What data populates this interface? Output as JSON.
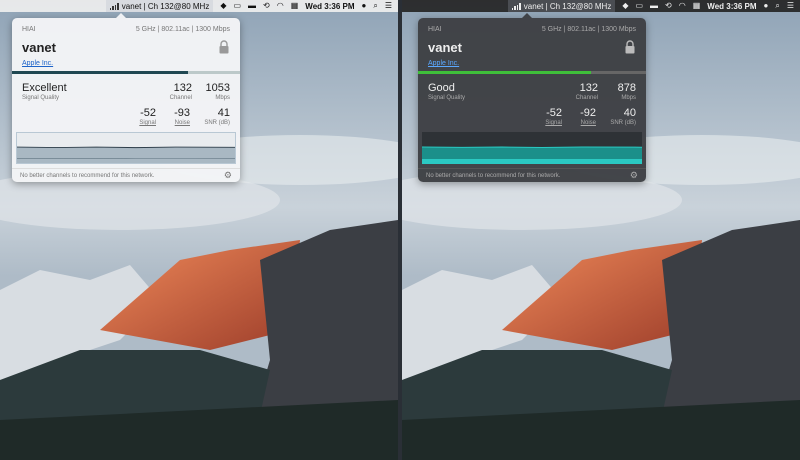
{
  "menubar": {
    "wifi_label": "vanet | Ch 132@80 MHz",
    "time": "Wed 3:36 PM"
  },
  "icons": {
    "dropbox": "◆",
    "airplay": "▭",
    "battery": "▬",
    "time_machine": "⟲",
    "wifi": "◠",
    "flag": "▦",
    "user": "●",
    "search": "⌕",
    "list": "☰",
    "gear": "⚙"
  },
  "colors": {
    "signal_bar_excellent": "#204852",
    "signal_bar_good": "#3fbf3a",
    "link": "#1d63c9"
  },
  "panels": [
    {
      "network_name": "HIAI",
      "band_info": "5 GHz | 802.11ac | 1300 Mbps",
      "ssid": "vanet",
      "vendor": "Apple Inc.",
      "signal_fraction": 0.77,
      "quality": "Excellent",
      "quality_label": "Signal Quality",
      "channel": "132",
      "channel_label": "Channel",
      "rate": "1053",
      "rate_label": "Mbps",
      "signal": "-52",
      "signal_label": "Signal",
      "noise": "-93",
      "noise_label": "Noise",
      "snr": "41",
      "snr_label": "SNR (dB)",
      "footer": "No better channels to recommend for this network."
    },
    {
      "network_name": "HIAI",
      "band_info": "5 GHz | 802.11ac | 1300 Mbps",
      "ssid": "vanet",
      "vendor": "Apple Inc.",
      "signal_fraction": 0.76,
      "quality": "Good",
      "quality_label": "Signal Quality",
      "channel": "132",
      "channel_label": "Channel",
      "rate": "878",
      "rate_label": "Mbps",
      "signal": "-52",
      "signal_label": "Signal",
      "noise": "-92",
      "noise_label": "Noise",
      "snr": "40",
      "snr_label": "SNR (dB)",
      "footer": "No better channels to recommend for this network."
    }
  ]
}
